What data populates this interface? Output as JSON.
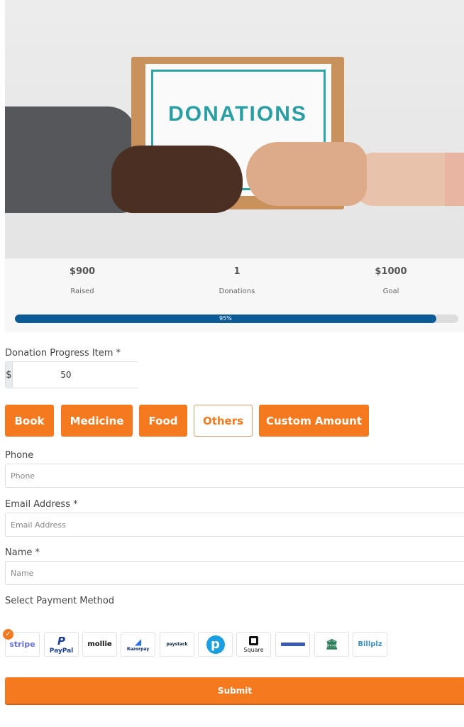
{
  "hero": {
    "box_text": "DONATIONS"
  },
  "stats": {
    "raised_value": "$900",
    "raised_label": "Raised",
    "donations_value": "1",
    "donations_label": "Donations",
    "goal_value": "$1000",
    "goal_label": "Goal",
    "progress_percent": 95,
    "progress_label": "95%",
    "progress_color": "#0c5a96"
  },
  "donation": {
    "label": "Donation Progress Item *",
    "currency": "$",
    "value": "50"
  },
  "items": [
    {
      "label": "Book",
      "selected": false
    },
    {
      "label": "Medicine",
      "selected": false
    },
    {
      "label": "Food",
      "selected": false
    },
    {
      "label": "Others",
      "selected": true
    },
    {
      "label": "Custom Amount",
      "selected": false
    }
  ],
  "fields": {
    "phone_label": "Phone",
    "phone_placeholder": "Phone",
    "email_label": "Email Address *",
    "email_placeholder": "Email Address",
    "name_label": "Name *",
    "name_placeholder": "Name"
  },
  "payment": {
    "label": "Select Payment Method",
    "methods": [
      "stripe",
      "PayPal",
      "mollie",
      "Razorpay",
      "paystack",
      "Payrexx",
      "Square",
      "Paymongo",
      "Offline",
      "Billplz"
    ],
    "selected": "stripe"
  },
  "submit_label": "Submit",
  "accent_color": "#f57a1f"
}
